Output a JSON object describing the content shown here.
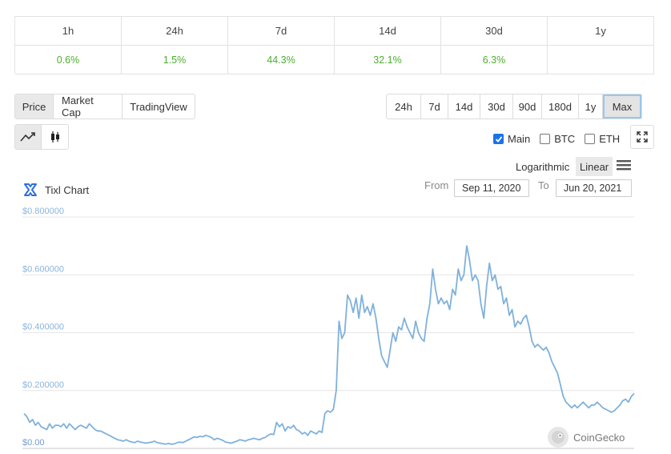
{
  "stats": {
    "headers": [
      "1h",
      "24h",
      "7d",
      "14d",
      "30d",
      "1y"
    ],
    "values": [
      "0.6%",
      "1.5%",
      "44.3%",
      "32.1%",
      "6.3%",
      ""
    ]
  },
  "tabs": {
    "items": [
      "Price",
      "Market Cap",
      "TradingView"
    ],
    "active": "Price"
  },
  "ranges": {
    "items": [
      "24h",
      "7d",
      "14d",
      "30d",
      "90d",
      "180d",
      "1y",
      "Max"
    ],
    "active": "Max"
  },
  "chart_type": {
    "active": "line"
  },
  "compare": {
    "main_label": "Main",
    "main_checked": true,
    "btc_label": "BTC",
    "btc_checked": false,
    "eth_label": "ETH",
    "eth_checked": false
  },
  "scale": {
    "log_label": "Logarithmic",
    "linear_label": "Linear",
    "active": "Linear"
  },
  "chart_header": {
    "title": "Tixl Chart",
    "from_label": "From",
    "from_value": "Sep 11, 2020",
    "to_label": "To",
    "to_value": "Jun 20, 2021"
  },
  "watermark": "CoinGecko",
  "colors": {
    "line": "#7fb1dc",
    "positive": "#4caf2e",
    "axis_label": "#8ab4dd",
    "accent": "#1a73e8"
  },
  "chart_data": {
    "type": "line",
    "title": "Tixl Chart",
    "xlabel": "",
    "ylabel": "",
    "x_range": [
      "Sep 11, 2020",
      "Jun 20, 2021"
    ],
    "ylim": [
      0,
      0.8
    ],
    "y_ticks": [
      0,
      0.2,
      0.4,
      0.6,
      0.8
    ],
    "y_tick_labels": [
      "$0.00",
      "$0.200000",
      "$0.400000",
      "$0.600000",
      "$0.800000"
    ],
    "grid": true,
    "series": [
      {
        "values": [
          0.12,
          0.11,
          0.09,
          0.1,
          0.08,
          0.09,
          0.075,
          0.07,
          0.065,
          0.085,
          0.07,
          0.08,
          0.08,
          0.075,
          0.085,
          0.07,
          0.085,
          0.075,
          0.065,
          0.075,
          0.08,
          0.075,
          0.07,
          0.085,
          0.075,
          0.065,
          0.06,
          0.06,
          0.055,
          0.05,
          0.045,
          0.04,
          0.035,
          0.03,
          0.028,
          0.025,
          0.03,
          0.025,
          0.022,
          0.02,
          0.025,
          0.022,
          0.02,
          0.018,
          0.02,
          0.022,
          0.025,
          0.02,
          0.018,
          0.016,
          0.015,
          0.017,
          0.014,
          0.016,
          0.02,
          0.022,
          0.02,
          0.025,
          0.03,
          0.035,
          0.04,
          0.038,
          0.042,
          0.04,
          0.045,
          0.042,
          0.038,
          0.03,
          0.035,
          0.032,
          0.028,
          0.022,
          0.02,
          0.018,
          0.022,
          0.025,
          0.03,
          0.028,
          0.025,
          0.03,
          0.032,
          0.035,
          0.032,
          0.03,
          0.035,
          0.038,
          0.045,
          0.05,
          0.048,
          0.09,
          0.075,
          0.085,
          0.06,
          0.075,
          0.07,
          0.08,
          0.065,
          0.06,
          0.05,
          0.055,
          0.045,
          0.06,
          0.055,
          0.05,
          0.06,
          0.055,
          0.12,
          0.13,
          0.125,
          0.135,
          0.2,
          0.44,
          0.38,
          0.4,
          0.53,
          0.51,
          0.47,
          0.52,
          0.45,
          0.53,
          0.47,
          0.49,
          0.46,
          0.5,
          0.45,
          0.38,
          0.32,
          0.3,
          0.28,
          0.34,
          0.4,
          0.37,
          0.42,
          0.41,
          0.45,
          0.42,
          0.4,
          0.38,
          0.44,
          0.4,
          0.38,
          0.37,
          0.45,
          0.5,
          0.62,
          0.55,
          0.5,
          0.52,
          0.5,
          0.51,
          0.48,
          0.55,
          0.53,
          0.62,
          0.58,
          0.6,
          0.7,
          0.65,
          0.58,
          0.6,
          0.58,
          0.5,
          0.45,
          0.56,
          0.64,
          0.58,
          0.6,
          0.55,
          0.56,
          0.5,
          0.52,
          0.46,
          0.48,
          0.42,
          0.44,
          0.43,
          0.45,
          0.46,
          0.42,
          0.37,
          0.35,
          0.36,
          0.35,
          0.34,
          0.35,
          0.33,
          0.3,
          0.28,
          0.26,
          0.22,
          0.18,
          0.16,
          0.15,
          0.14,
          0.15,
          0.14,
          0.15,
          0.16,
          0.15,
          0.14,
          0.15,
          0.15,
          0.16,
          0.15,
          0.14,
          0.135,
          0.13,
          0.125,
          0.13,
          0.14,
          0.15,
          0.165,
          0.17,
          0.16,
          0.18,
          0.19
        ]
      }
    ]
  }
}
